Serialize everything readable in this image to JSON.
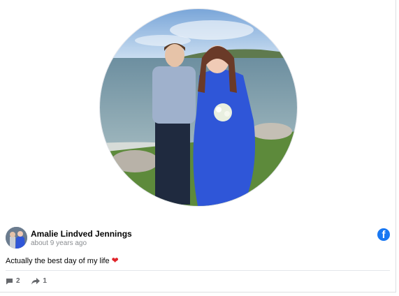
{
  "post": {
    "author": "Amalie Lindved Jennings",
    "time": "about 9 years ago",
    "text": "Actually the best day of my life",
    "emoji_icon": "red-heart-icon",
    "comments_count": "2",
    "shares_count": "1"
  },
  "icons": {
    "platform": "facebook-logo-icon",
    "comments": "comment-bubble-icon",
    "shares": "share-arrow-icon"
  },
  "colors": {
    "facebook_blue": "#1877f2",
    "heart_red": "#e0242a",
    "muted_text": "#8a8d91"
  }
}
